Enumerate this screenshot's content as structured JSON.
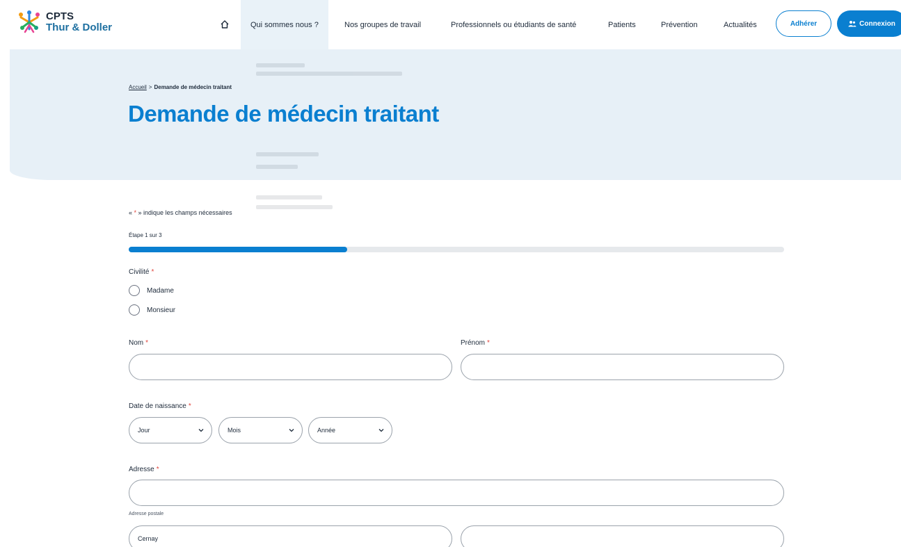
{
  "header": {
    "logo": {
      "line1": "CPTS",
      "line2": "Thur & Doller"
    },
    "nav": [
      {
        "label": "Qui sommes nous ?",
        "active": true
      },
      {
        "label": "Nos groupes de travail",
        "active": false
      },
      {
        "label": "Professionnels ou étudiants de santé",
        "active": false
      },
      {
        "label": "Patients",
        "active": false
      },
      {
        "label": "Prévention",
        "active": false
      },
      {
        "label": "Actualités",
        "active": false
      }
    ],
    "adherer_label": "Adhérer",
    "connexion_label": "Connexion"
  },
  "hero": {
    "breadcrumb": {
      "home": "Accueil",
      "separator": ">",
      "current": "Demande de médecin traitant"
    },
    "title": "Demande de médecin traitant"
  },
  "form": {
    "required_note": {
      "prefix": "« ",
      "star": "*",
      "suffix": " » indique les champs nécessaires"
    },
    "step": {
      "label": "Étape 1 sur 3",
      "progress_fraction": 0.333
    },
    "civilite": {
      "label": "Civilité",
      "options": [
        "Madame",
        "Monsieur"
      ]
    },
    "nom": {
      "label": "Nom",
      "value": ""
    },
    "prenom": {
      "label": "Prénom",
      "value": ""
    },
    "date_naissance": {
      "label": "Date de naissance",
      "jour": "Jour",
      "mois": "Mois",
      "annee": "Année"
    },
    "adresse": {
      "label": "Adresse",
      "value": "",
      "help": "Adresse postale"
    },
    "ville": {
      "value": "Cernay"
    },
    "code_postal": {
      "value": ""
    }
  },
  "colors": {
    "accent": "#0a7fd0",
    "required": "#e0443c",
    "hero_bg": "#e7f0f7"
  }
}
